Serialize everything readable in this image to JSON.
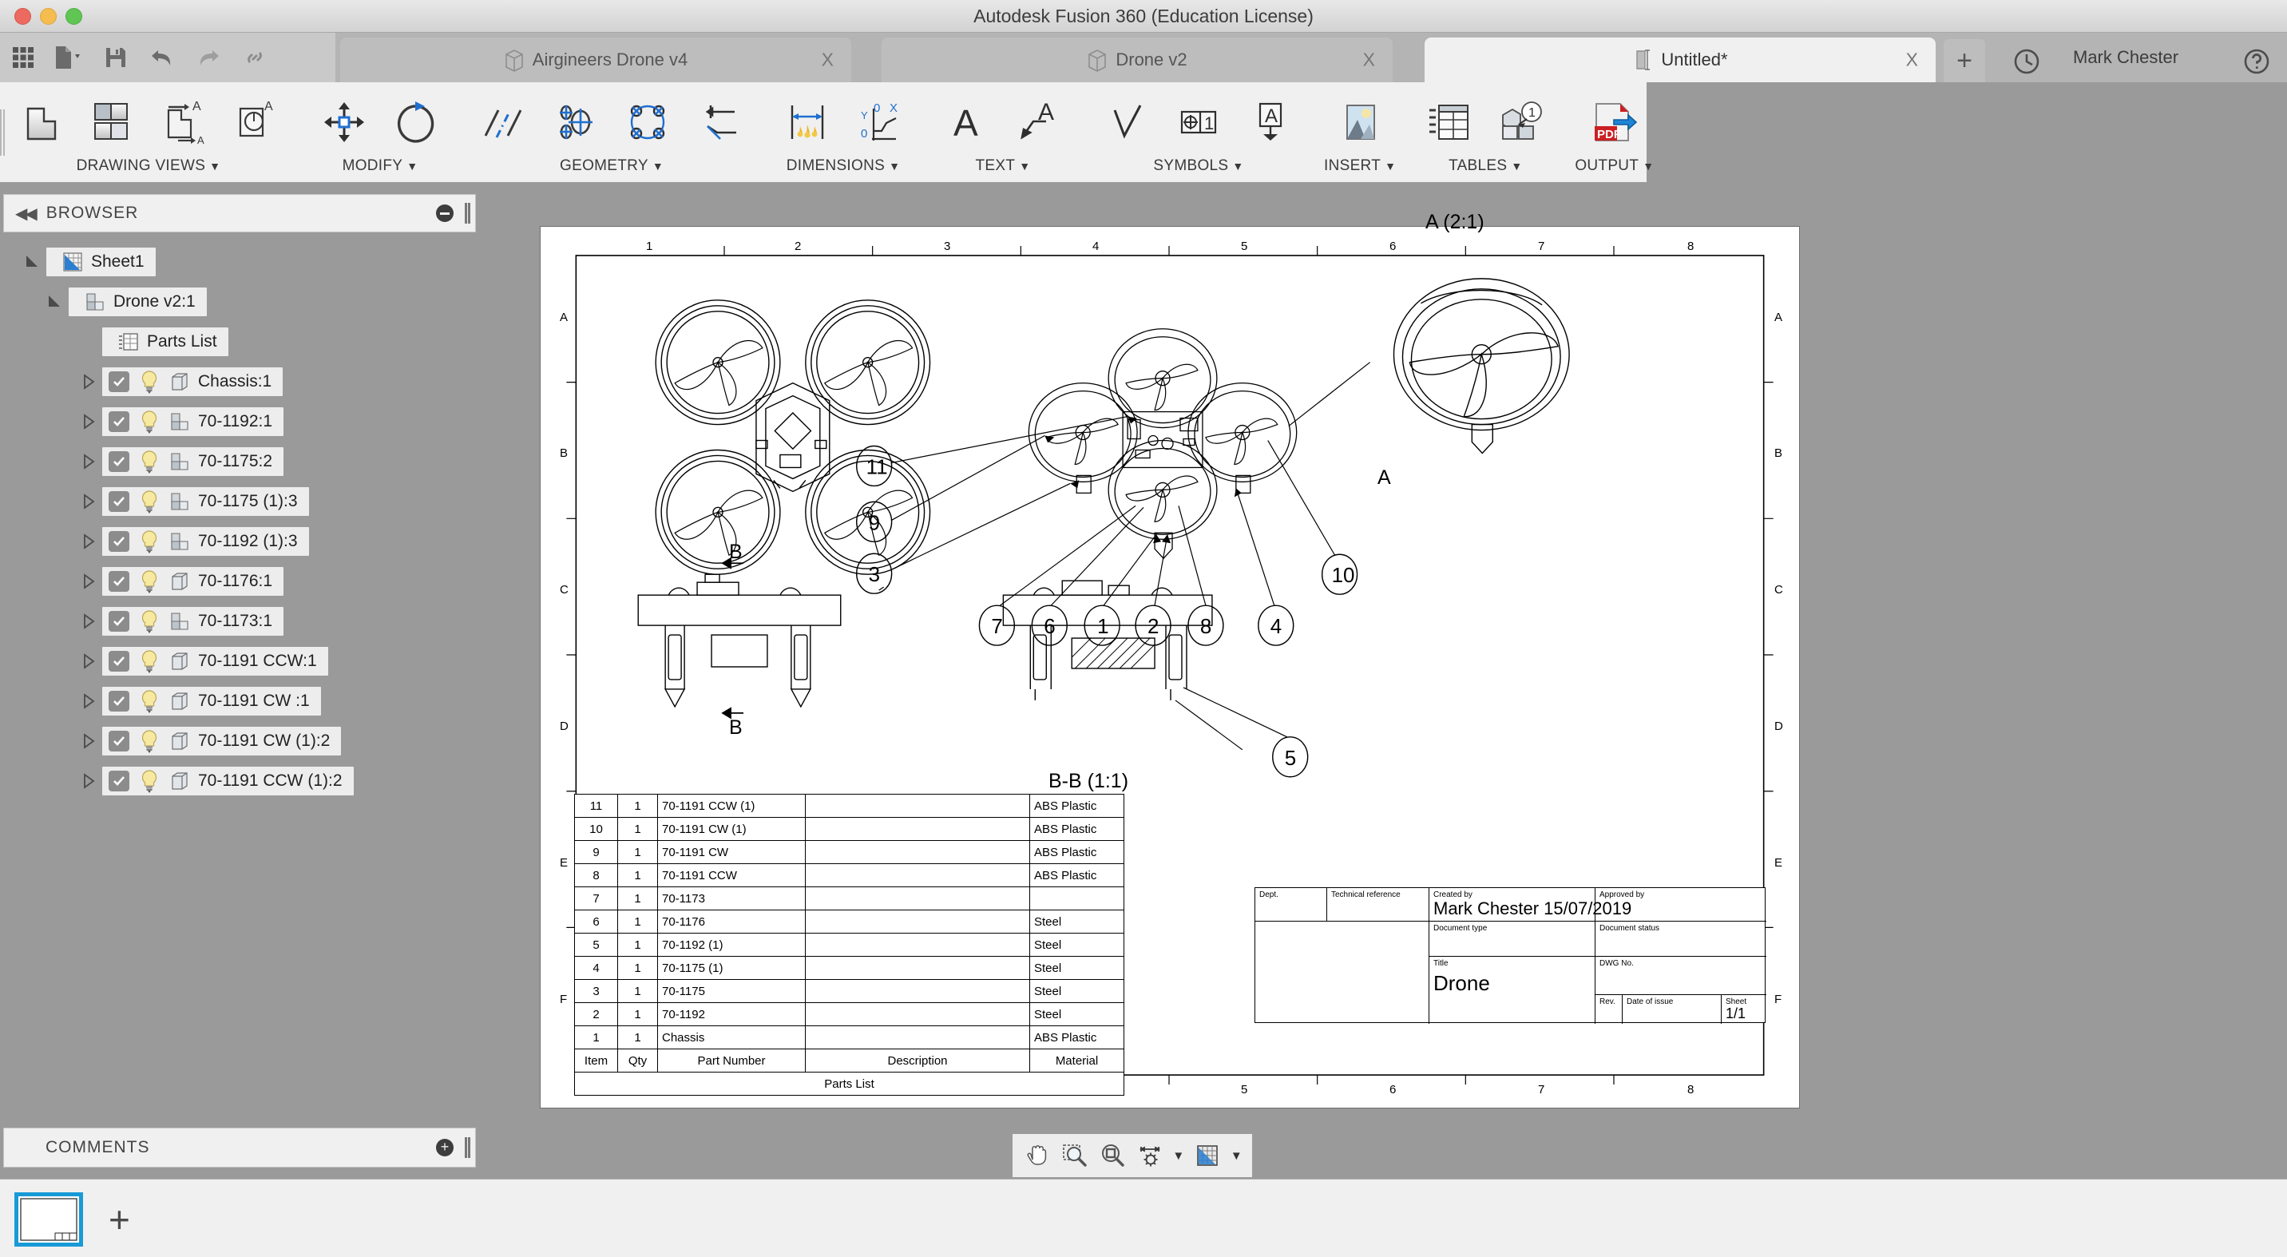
{
  "window": {
    "title": "Autodesk Fusion 360 (Education License)"
  },
  "traffic_lights": {
    "close": "close",
    "minimize": "minimize",
    "zoom": "zoom"
  },
  "quick_access": [
    {
      "name": "app-grid",
      "label": "Show Data Panel"
    },
    {
      "name": "new-file",
      "label": "File"
    },
    {
      "name": "save",
      "label": "Save"
    },
    {
      "name": "undo",
      "label": "Undo"
    },
    {
      "name": "redo",
      "label": "Redo"
    },
    {
      "name": "link",
      "label": "Link"
    }
  ],
  "tabs": [
    {
      "label": "Airgineers Drone v4",
      "close": "X",
      "active": false
    },
    {
      "label": "Drone v2",
      "close": "X",
      "active": false
    },
    {
      "label": "Untitled*",
      "close": "X",
      "active": true
    }
  ],
  "tab_add_label": "+",
  "account": {
    "user": "Mark Chester",
    "help_label": "?"
  },
  "ribbon": {
    "panels": [
      {
        "label": "DRAWING VIEWS",
        "caret": "▼",
        "icons": [
          "base-view-icon",
          "projected-view-icon",
          "section-view-icon",
          "detail-view-icon"
        ]
      },
      {
        "label": "MODIFY",
        "caret": "▼",
        "icons": [
          "move-icon",
          "rotate-icon"
        ]
      },
      {
        "label": "GEOMETRY",
        "caret": "▼",
        "icons": [
          "centerline-icon",
          "center-mark-icon",
          "bolt-circle-centermark-icon",
          "edge-extension-icon"
        ]
      },
      {
        "label": "DIMENSIONS",
        "caret": "▼",
        "icons": [
          "dimension-icon",
          "ordinate-dimension-icon"
        ]
      },
      {
        "label": "TEXT",
        "caret": "▼",
        "icons": [
          "text-icon",
          "leader-text-icon"
        ]
      },
      {
        "label": "SYMBOLS",
        "caret": "▼",
        "icons": [
          "surface-texture-icon",
          "feature-control-frame-icon",
          "datum-identifier-icon"
        ]
      },
      {
        "label": "INSERT",
        "caret": "▼",
        "icons": [
          "insert-image-icon"
        ]
      },
      {
        "label": "TABLES",
        "caret": "▼",
        "icons": [
          "table-icon",
          "balloon-icon"
        ]
      },
      {
        "label": "OUTPUT",
        "caret": "▼",
        "icons": [
          "export-pdf-icon"
        ]
      }
    ]
  },
  "browser": {
    "title": "BROWSER",
    "collapse_label": "◀◀",
    "tree": [
      {
        "label": "Sheet1",
        "indent": 0,
        "expander": "open",
        "icon": "sheet-icon",
        "checkbox": false,
        "bulb": false
      },
      {
        "label": "Drone v2:1",
        "indent": 1,
        "expander": "open",
        "icon": "assembly-icon",
        "checkbox": false,
        "bulb": false
      },
      {
        "label": "Parts List",
        "indent": 2,
        "expander": "none",
        "icon": "table-icon",
        "checkbox": false,
        "bulb": false
      },
      {
        "label": "Chassis:1",
        "indent": 2,
        "expander": "closed",
        "icon": "body-icon",
        "checkbox": true,
        "bulb": true
      },
      {
        "label": "70-1192:1",
        "indent": 2,
        "expander": "closed",
        "icon": "assembly-icon",
        "checkbox": true,
        "bulb": true
      },
      {
        "label": "70-1175:2",
        "indent": 2,
        "expander": "closed",
        "icon": "assembly-icon",
        "checkbox": true,
        "bulb": true
      },
      {
        "label": "70-1175 (1):3",
        "indent": 2,
        "expander": "closed",
        "icon": "assembly-icon",
        "checkbox": true,
        "bulb": true
      },
      {
        "label": "70-1192 (1):3",
        "indent": 2,
        "expander": "closed",
        "icon": "assembly-icon",
        "checkbox": true,
        "bulb": true
      },
      {
        "label": "70-1176:1",
        "indent": 2,
        "expander": "closed",
        "icon": "body-icon",
        "checkbox": true,
        "bulb": true
      },
      {
        "label": "70-1173:1",
        "indent": 2,
        "expander": "closed",
        "icon": "assembly-icon",
        "checkbox": true,
        "bulb": true
      },
      {
        "label": "70-1191 CCW:1",
        "indent": 2,
        "expander": "closed",
        "icon": "body-icon",
        "checkbox": true,
        "bulb": true
      },
      {
        "label": "70-1191 CW :1",
        "indent": 2,
        "expander": "closed",
        "icon": "body-icon",
        "checkbox": true,
        "bulb": true
      },
      {
        "label": "70-1191 CW (1):2",
        "indent": 2,
        "expander": "closed",
        "icon": "body-icon",
        "checkbox": true,
        "bulb": true
      },
      {
        "label": "70-1191 CCW (1):2",
        "indent": 2,
        "expander": "closed",
        "icon": "body-icon",
        "checkbox": true,
        "bulb": true
      }
    ]
  },
  "comments": {
    "title": "COMMENTS",
    "add_label": "+"
  },
  "nav_toolbar": [
    {
      "name": "pan-icon",
      "label": "Pan"
    },
    {
      "name": "zoom-window-icon",
      "label": "Zoom Window"
    },
    {
      "name": "zoom-fit-icon",
      "label": "Fit"
    },
    {
      "name": "display-settings-icon",
      "label": "Display Settings"
    },
    {
      "name": "grid-snaps-icon",
      "label": "Grid and Snaps"
    }
  ],
  "sheet_tabs": {
    "thumb_name": "Sheet1",
    "add_label": "+"
  },
  "drawing": {
    "zone_cols": [
      "1",
      "2",
      "3",
      "4",
      "5",
      "6",
      "7",
      "8"
    ],
    "zone_rows": [
      "A",
      "B",
      "C",
      "D",
      "E",
      "F"
    ],
    "detail_view_label": "A (2:1)",
    "detail_marker": "A",
    "section_marks": [
      "B",
      "B"
    ],
    "section_view_label": "B-B (1:1)",
    "balloons": [
      "11",
      "9",
      "3",
      "7",
      "6",
      "1",
      "2",
      "8",
      "4",
      "10",
      "5"
    ],
    "parts_list": {
      "caption": "Parts List",
      "columns": [
        "Item",
        "Qty",
        "Part Number",
        "Description",
        "Material"
      ],
      "rows": [
        [
          "11",
          "1",
          "70-1191 CCW (1)",
          "",
          "ABS Plastic"
        ],
        [
          "10",
          "1",
          "70-1191 CW (1)",
          "",
          "ABS Plastic"
        ],
        [
          "9",
          "1",
          "70-1191 CW",
          "",
          "ABS Plastic"
        ],
        [
          "8",
          "1",
          "70-1191 CCW",
          "",
          "ABS Plastic"
        ],
        [
          "7",
          "1",
          "70-1173",
          "",
          ""
        ],
        [
          "6",
          "1",
          "70-1176",
          "",
          "Steel"
        ],
        [
          "5",
          "1",
          "70-1192 (1)",
          "",
          "Steel"
        ],
        [
          "4",
          "1",
          "70-1175 (1)",
          "",
          "Steel"
        ],
        [
          "3",
          "1",
          "70-1175",
          "",
          "Steel"
        ],
        [
          "2",
          "1",
          "70-1192",
          "",
          "Steel"
        ],
        [
          "1",
          "1",
          "Chassis",
          "",
          "ABS Plastic"
        ]
      ]
    },
    "title_block": {
      "dept_label": "Dept.",
      "dept_value": "",
      "techref_label": "Technical reference",
      "techref_value": "",
      "created_label": "Created by",
      "created_value": "Mark Chester    15/07/2019",
      "approved_label": "Approved by",
      "approved_value": "",
      "doctype_label": "Document type",
      "doctype_value": "",
      "docstatus_label": "Document status",
      "docstatus_value": "",
      "title_label": "Title",
      "title_value": "Drone",
      "dwgno_label": "DWG No.",
      "dwgno_value": "",
      "rev_label": "Rev.",
      "rev_value": "",
      "dateissue_label": "Date of issue",
      "dateissue_value": "",
      "sheet_label": "Sheet",
      "sheet_value": "1/1"
    }
  },
  "colors": {
    "accent": "#189ad6",
    "ribbon_bg": "#f0f0f0",
    "chrome": "#9a9a9a",
    "pdf_red": "#cc1f23"
  }
}
